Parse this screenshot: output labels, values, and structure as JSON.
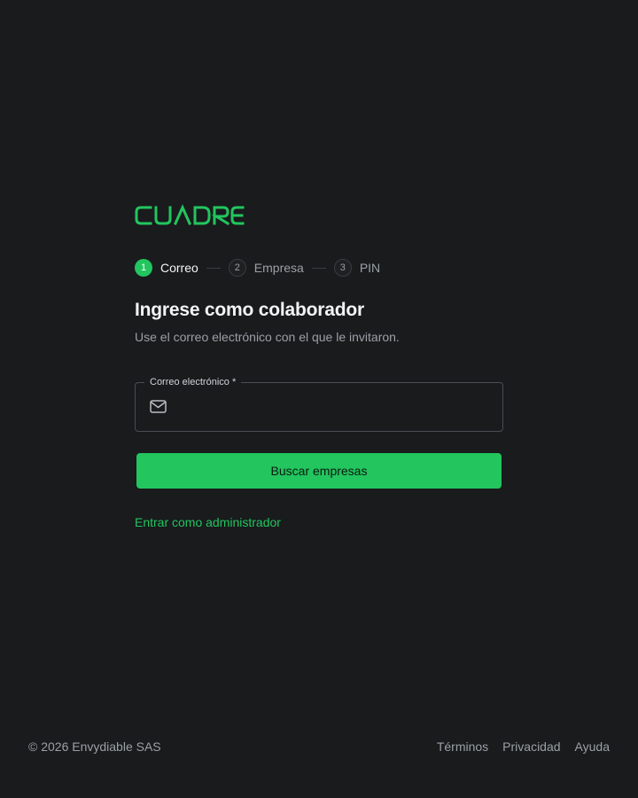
{
  "brand": {
    "name": "CUADRE",
    "accent_color": "#22c55e"
  },
  "stepper": {
    "steps": [
      {
        "number": "1",
        "label": "Correo",
        "state": "active"
      },
      {
        "number": "2",
        "label": "Empresa",
        "state": "inactive"
      },
      {
        "number": "3",
        "label": "PIN",
        "state": "inactive"
      }
    ]
  },
  "form": {
    "title": "Ingrese como colaborador",
    "subtitle": "Use el correo electrónico con el que le invitaron.",
    "email_field": {
      "label": "Correo electrónico",
      "required_mark": "*",
      "value": "",
      "placeholder": "",
      "icon": "mail-icon"
    },
    "submit_label": "Buscar empresas",
    "admin_link_label": "Entrar como administrador"
  },
  "footer": {
    "copyright": "© 2026 Envydiable SAS",
    "links": [
      {
        "label": "Términos"
      },
      {
        "label": "Privacidad"
      },
      {
        "label": "Ayuda"
      }
    ]
  }
}
